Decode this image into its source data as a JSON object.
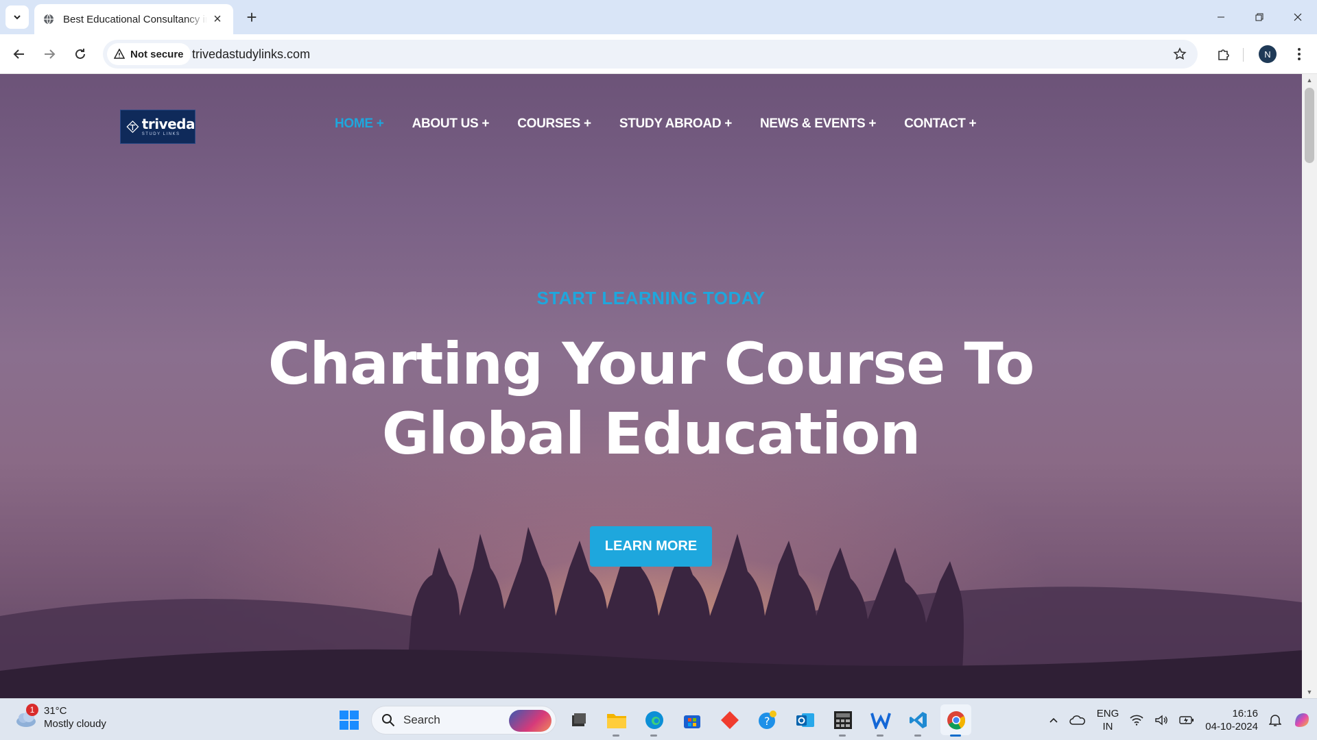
{
  "browser": {
    "tab": {
      "title": "Best Educational Consultancy in Hyderabad | Triveda Study Links"
    },
    "new_tab_label": "+",
    "security_label": "Not secure",
    "url": "trivedastudylinks.com",
    "profile_initial": "N"
  },
  "site": {
    "logo": {
      "name": "triveda",
      "sub": "STUDY LINKS"
    },
    "nav": [
      {
        "label": "HOME +",
        "active": true
      },
      {
        "label": "ABOUT US +"
      },
      {
        "label": "COURSES +"
      },
      {
        "label": "STUDY ABROAD +"
      },
      {
        "label": "NEWS & EVENTS +"
      },
      {
        "label": "CONTACT +"
      }
    ],
    "hero": {
      "kicker": "START LEARNING TODAY",
      "headline_line1": "Charting Your Course To",
      "headline_line2": "Global Education",
      "cta_label": "LEARN MORE"
    },
    "colors": {
      "accent": "#1ea7dd",
      "logo_bg": "#0f2a5a"
    }
  },
  "taskbar": {
    "weather": {
      "temp": "31°C",
      "desc": "Mostly cloudy",
      "badge": "1"
    },
    "search_placeholder": "Search",
    "apps": [
      "windows-start-icon",
      "file-explorer-icon",
      "edge-icon",
      "store-icon",
      "git-icon",
      "help-icon",
      "outlook-icon",
      "calculator-app-icon",
      "wps-writer-icon",
      "vscode-icon",
      "chrome-icon"
    ],
    "language": {
      "line1": "ENG",
      "line2": "IN"
    },
    "clock": {
      "time": "16:16",
      "date": "04-10-2024"
    }
  }
}
